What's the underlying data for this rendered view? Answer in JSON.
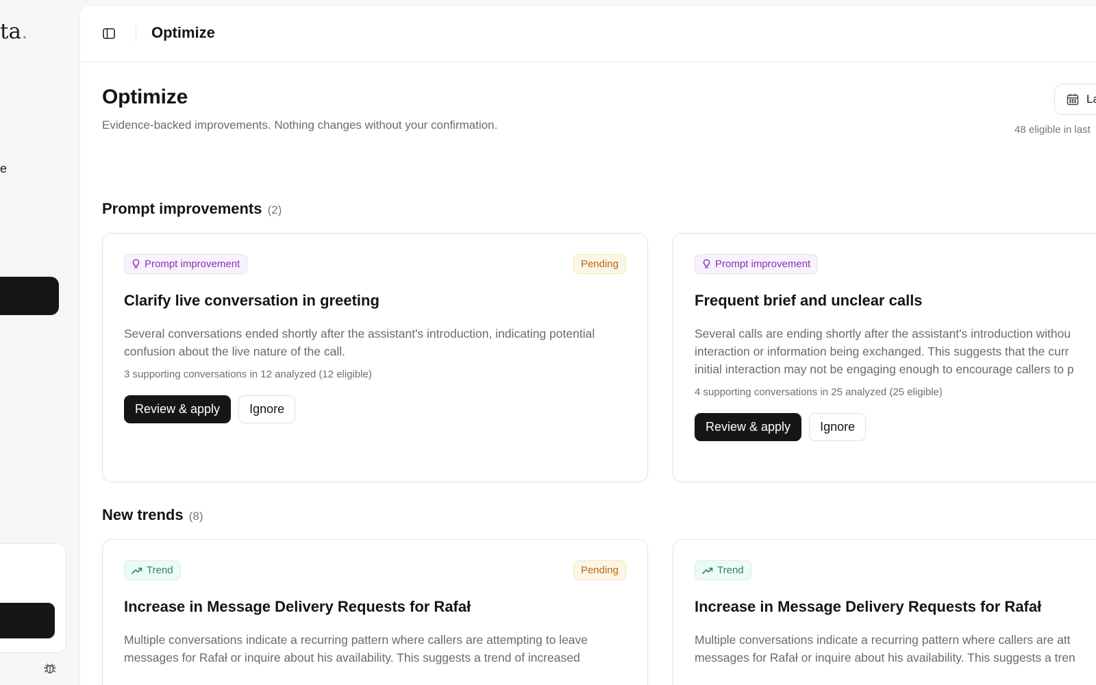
{
  "sidebar": {
    "logo_text": "ta",
    "logo_dot": ".",
    "nav_fragment": "e"
  },
  "topbar": {
    "title": "Optimize"
  },
  "header": {
    "title": "Optimize",
    "subtitle": "Evidence-backed improvements. Nothing changes without your confirmation.",
    "date_button_label": "La",
    "eligible_note": "48 eligible in last"
  },
  "sections": {
    "prompt": {
      "title": "Prompt improvements",
      "count": "(2)"
    },
    "trends": {
      "title": "New trends",
      "count": "(8)"
    }
  },
  "prompt_cards": [
    {
      "tag": "Prompt improvement",
      "status": "Pending",
      "title": "Clarify live conversation in greeting",
      "desc_lines": [
        "Several conversations ended shortly after the assistant's introduction, indicating potential",
        "confusion about the live nature of the call."
      ],
      "meta": "3 supporting conversations in 12 analyzed (12 eligible)",
      "primary_label": "Review & apply",
      "secondary_label": "Ignore"
    },
    {
      "tag": "Prompt improvement",
      "title": "Frequent brief and unclear calls",
      "desc_lines": [
        "Several calls are ending shortly after the assistant's introduction withou",
        "interaction or information being exchanged. This suggests that the curr",
        "initial interaction may not be engaging enough to encourage callers to p"
      ],
      "meta": "4 supporting conversations in 25 analyzed (25 eligible)",
      "primary_label": "Review & apply",
      "secondary_label": "Ignore"
    }
  ],
  "trend_cards": [
    {
      "tag": "Trend",
      "status": "Pending",
      "title": "Increase in Message Delivery Requests for Rafał",
      "desc_lines": [
        "Multiple conversations indicate a recurring pattern where callers are attempting to leave",
        "messages for Rafał or inquire about his availability. This suggests a trend of increased"
      ]
    },
    {
      "tag": "Trend",
      "title": "Increase in Message Delivery Requests for Rafał",
      "desc_lines": [
        "Multiple conversations indicate a recurring pattern where callers are att",
        "messages for Rafał or inquire about his availability. This suggests a tren"
      ]
    }
  ]
}
